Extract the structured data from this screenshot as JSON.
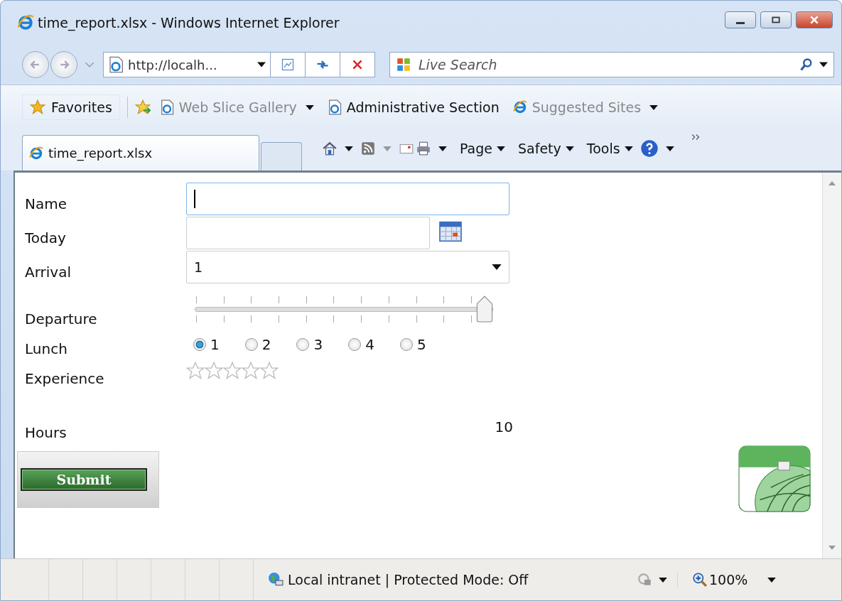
{
  "window": {
    "title": "time_report.xlsx - Windows Internet Explorer"
  },
  "address": {
    "url": "http://localh..."
  },
  "search": {
    "placeholder": "Live Search"
  },
  "favorites": {
    "label": "Favorites",
    "links": [
      {
        "label": "Web Slice Gallery",
        "disabled": true,
        "dropdown": true,
        "kind": "page"
      },
      {
        "label": "Administrative Section",
        "disabled": false,
        "dropdown": false,
        "kind": "page"
      },
      {
        "label": "Suggested Sites",
        "disabled": true,
        "dropdown": true,
        "kind": "ie"
      }
    ]
  },
  "tabs": [
    {
      "label": "time_report.xlsx",
      "selected": true
    }
  ],
  "commands": [
    "Page",
    "Safety",
    "Tools"
  ],
  "form": {
    "rows": [
      {
        "kind": "text",
        "label": "Name",
        "focused": true
      },
      {
        "kind": "date",
        "label": "Today"
      },
      {
        "kind": "select",
        "label": "Arrival",
        "value": "1"
      },
      {
        "kind": "slider",
        "label": "Departure",
        "level": 1
      },
      {
        "kind": "radio",
        "label": "Lunch",
        "options": [
          {
            "label": "1",
            "selected": true
          },
          {
            "label": "2",
            "selected": false
          },
          {
            "label": "3",
            "selected": false
          },
          {
            "label": "4",
            "selected": false
          },
          {
            "label": "5",
            "selected": false
          }
        ]
      },
      {
        "kind": "rating",
        "label": "Experience",
        "stars": 0
      },
      {
        "kind": "output",
        "label": "Hours",
        "value": "10"
      }
    ],
    "submit": "Submit"
  },
  "status_bar": {
    "zone": "Local intranet | Protected Mode: Off",
    "zoom": "100%"
  }
}
